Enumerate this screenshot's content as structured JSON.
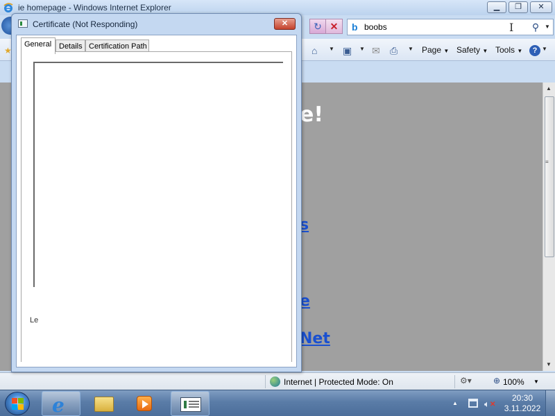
{
  "ie": {
    "title": "ie homepage - Windows Internet Explorer",
    "search": {
      "value": "boobs"
    },
    "command_bar": {
      "page_label": "Page",
      "safety_label": "Safety",
      "tools_label": "Tools"
    },
    "page": {
      "heading_fragment": "e!",
      "link_fragments": [
        "s",
        "e",
        "Net"
      ]
    },
    "status": {
      "zone_text": "Internet | Protected Mode: On",
      "zoom_text": "100%"
    }
  },
  "certificate_dialog": {
    "title": "Certificate (Not Responding)",
    "tabs": [
      "General",
      "Details",
      "Certification Path"
    ],
    "active_tab": "General",
    "learn_more_fragment": "Le"
  },
  "taskbar": {
    "apps": [
      "internet-explorer",
      "windows-explorer",
      "media-player",
      "certificate"
    ],
    "clock": {
      "time": "20:30",
      "date": "3.11.2022"
    }
  },
  "colors": {
    "page_background": "#a0a0a0",
    "link": "#1a50d0",
    "heading": "#ffffff"
  }
}
